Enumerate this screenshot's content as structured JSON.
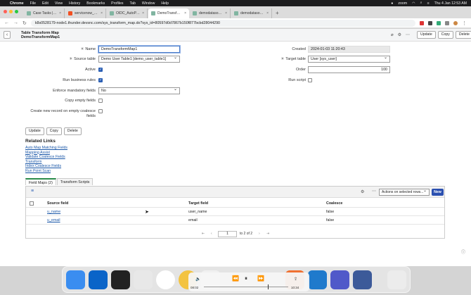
{
  "menubar": {
    "app": "Chrome",
    "items": [
      "File",
      "Edit",
      "View",
      "History",
      "Bookmarks",
      "Profiles",
      "Tab",
      "Window",
      "Help"
    ],
    "zoom": "zoom",
    "clock": "Thu 4 Jan  12:53 AM"
  },
  "browser": {
    "tabs": [
      {
        "label": "Case Tasks | ServiceNow",
        "active": false
      },
      {
        "label": "servicenow_TestAmbuj - Mic",
        "active": false
      },
      {
        "label": "OIDC_AutoProvisionDemo | S",
        "active": false
      },
      {
        "label": "DemoTransformMap1 | Table",
        "active": true
      },
      {
        "label": "demodatasource | Data Sourc",
        "active": false
      },
      {
        "label": "demodatasource | Data Sourc",
        "active": false
      }
    ],
    "url": "k8s0528179-node1.thunder.devsnc.com/sys_transform_map.do?sys_id=80597d0d7867b150f877bcbd28044290"
  },
  "header": {
    "title_line1": "Table Transform Map",
    "title_line2": "DemoTransformMap1",
    "buttons": [
      "Update",
      "Copy",
      "Delete"
    ]
  },
  "form": {
    "name_label": "Name",
    "name_value": "DemoTransformMap1",
    "source_table_label": "Source table",
    "source_table_value": "Demo User Table1 [demo_user_table1]",
    "active_label": "Active",
    "run_business_rules_label": "Run business rules",
    "enforce_label": "Enforce mandatory fields",
    "enforce_value": "No",
    "copy_empty_label": "Copy empty fields",
    "create_new_label_1": "Create new record on empty coalesce",
    "create_new_label_2": "fields",
    "created_label": "Created",
    "created_value": "2024-01-03 11:20:43",
    "target_table_label": "Target table",
    "target_table_value": "User [sys_user]",
    "order_label": "Order",
    "order_value": "100",
    "run_script_label": "Run script",
    "active_checked": true,
    "run_business_rules_checked": true
  },
  "bottom_buttons": [
    "Update",
    "Copy",
    "Delete"
  ],
  "related_links": {
    "title": "Related Links",
    "links": [
      "Auto Map Matching Fields",
      "Mapping Assist",
      "Validate Coalesce Fields",
      "Transform",
      "Index Coalesce Fields",
      "Run Point Scan"
    ]
  },
  "related_tabs": [
    "Field Maps (2)",
    "Transform Scripts"
  ],
  "field_maps": {
    "actions_placeholder": "Actions on selected rows...",
    "new_label": "New",
    "columns": [
      "Source field",
      "Target field",
      "Coalesce"
    ],
    "rows": [
      {
        "source": "u_name",
        "target": "user_name",
        "coalesce": "false"
      },
      {
        "source": "u_email",
        "target": "email",
        "coalesce": "false"
      }
    ],
    "pager_page": "1",
    "pager_text": "to 2 of 2"
  },
  "media": {
    "elapsed": "08:02",
    "remaining": "10:34"
  },
  "colors": {
    "accent": "#2b5fb4",
    "new_button": "#2b50b0",
    "active_tab_border": "#2a8c4a"
  }
}
